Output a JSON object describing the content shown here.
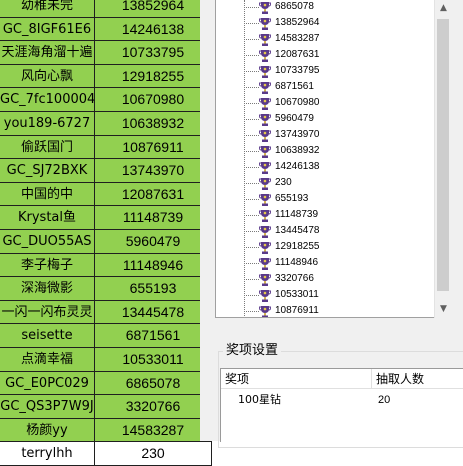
{
  "sheet": {
    "rows": [
      {
        "name": "幼稚未完",
        "id": "13852964"
      },
      {
        "name": "GC_8IGF61E6",
        "id": "14246138"
      },
      {
        "name": "天涯海角溜十遍",
        "id": "10733795"
      },
      {
        "name": "风向心飘",
        "id": "12918255"
      },
      {
        "name": "GC_7fc100004",
        "id": "10670980"
      },
      {
        "name": "you189-6727",
        "id": "10638932"
      },
      {
        "name": "偷跃国门",
        "id": "10876911"
      },
      {
        "name": "GC_SJ72BXK",
        "id": "13743970"
      },
      {
        "name": "中国的中",
        "id": "12087631"
      },
      {
        "name": "Krystal鱼",
        "id": "11148739"
      },
      {
        "name": "GC_DUO55AS",
        "id": "5960479"
      },
      {
        "name": "李子梅子",
        "id": "11148946"
      },
      {
        "name": "深海微影",
        "id": "655193"
      },
      {
        "name": "一闪一闪布灵灵",
        "id": "13445478"
      },
      {
        "name": "seisette",
        "id": "6871561"
      },
      {
        "name": "点滴幸福",
        "id": "10533011"
      },
      {
        "name": "GC_E0PC029",
        "id": "6865078"
      },
      {
        "name": "GC_QS3P7W9J",
        "id": "3320766"
      },
      {
        "name": "杨颜yy",
        "id": "14583287"
      },
      {
        "name": "terrylhh",
        "id": "230"
      }
    ]
  },
  "tree": {
    "icon": "trophy-icon",
    "items": [
      "6865078",
      "13852964",
      "14583287",
      "12087631",
      "10733795",
      "6871561",
      "10670980",
      "5960479",
      "13743970",
      "10638932",
      "14246138",
      "230",
      "655193",
      "11148739",
      "13445478",
      "12918255",
      "11148946",
      "3320766",
      "10533011",
      "10876911"
    ]
  },
  "awards": {
    "title": "奖项设置",
    "columns": [
      "奖项",
      "抽取人数"
    ],
    "rows": [
      {
        "prize": "100星钻",
        "count": "20"
      }
    ]
  },
  "colors": {
    "sheet_green": "#92d050",
    "panel_bg": "#f0f0f0"
  }
}
